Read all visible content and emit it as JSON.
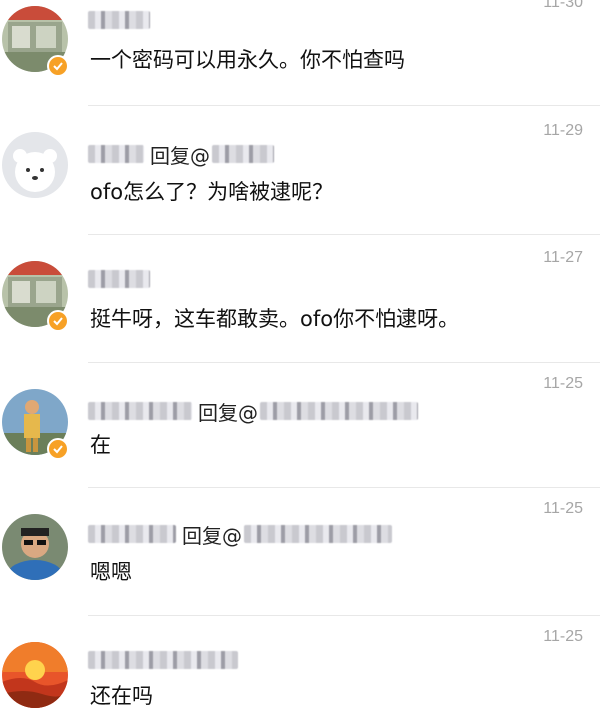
{
  "reply_label": "回复@",
  "comments": [
    {
      "date": "11-30",
      "text": "一个密码可以用永久。你不怕查吗",
      "verified": true,
      "is_reply": false
    },
    {
      "date": "11-29",
      "text": "ofo怎么了？为啥被逮呢？",
      "verified": false,
      "is_reply": true
    },
    {
      "date": "11-27",
      "text": "挺牛呀，这车都敢卖。ofo你不怕逮呀。",
      "verified": true,
      "is_reply": false
    },
    {
      "date": "11-25",
      "text": "在",
      "verified": true,
      "is_reply": true
    },
    {
      "date": "11-25",
      "text": "嗯嗯",
      "verified": false,
      "is_reply": true
    },
    {
      "date": "11-25",
      "text": "还在吗",
      "verified": false,
      "is_reply": false
    }
  ],
  "colors": {
    "verified_badge": "#f7a126",
    "date_text": "#a6a6a6",
    "divider": "#e8e8e8"
  }
}
